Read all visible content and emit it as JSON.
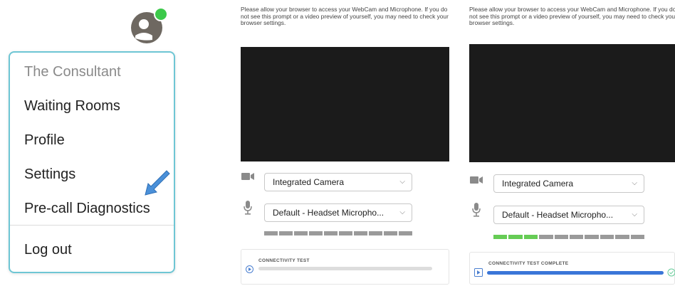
{
  "menu": {
    "header": "The Consultant",
    "items": [
      "Waiting Rooms",
      "Profile",
      "Settings",
      "Pre-call Diagnostics"
    ],
    "logout": "Log out"
  },
  "diag_before": {
    "note": "Please allow your browser to access your WebCam and Microphone. If you do not see this prompt or a video preview of yourself, you may need to check your browser settings.",
    "camera": "Integrated Camera",
    "microphone": "Default - Headset Micropho...",
    "test_title": "CONNECTIVITY TEST",
    "progress": 0,
    "mic_level_segments_active": 0
  },
  "diag_after": {
    "note": "Please allow your browser to access your WebCam and Microphone. If you do not see this prompt or a video preview of yourself, you may need to check your browser settings.",
    "camera": "Integrated Camera",
    "microphone": "Default - Headset Micropho...",
    "test_title": "CONNECTIVITY TEST COMPLETE",
    "progress": 1,
    "mic_level_segments_active": 3
  },
  "colors": {
    "accent": "#6ec6d4",
    "avatar_gray": "#6e6861",
    "status_green": "#3cc94a",
    "progress_blue": "#3a76d8",
    "level_green": "#66cc55"
  },
  "icons": [
    "user-avatar-icon",
    "online-status-icon",
    "pointer-arrow-icon",
    "camera-icon",
    "microphone-icon",
    "chevron-down-icon",
    "play-icon",
    "check-circle-icon"
  ]
}
